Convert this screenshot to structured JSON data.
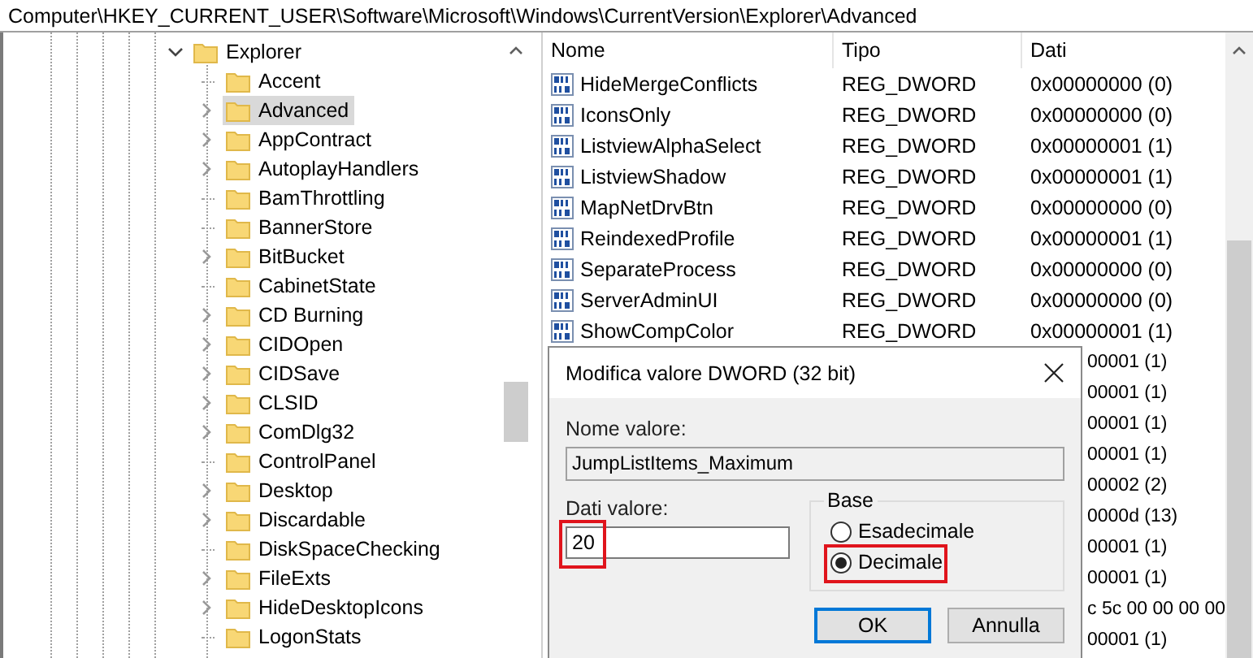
{
  "address_bar": "Computer\\HKEY_CURRENT_USER\\Software\\Microsoft\\Windows\\CurrentVersion\\Explorer\\Advanced",
  "tree": {
    "label": "Explorer",
    "expanded": true,
    "children": [
      {
        "label": "Accent",
        "expandable": false,
        "selected": false
      },
      {
        "label": "Advanced",
        "expandable": true,
        "selected": true
      },
      {
        "label": "AppContract",
        "expandable": true,
        "selected": false
      },
      {
        "label": "AutoplayHandlers",
        "expandable": true,
        "selected": false
      },
      {
        "label": "BamThrottling",
        "expandable": false,
        "selected": false
      },
      {
        "label": "BannerStore",
        "expandable": false,
        "selected": false
      },
      {
        "label": "BitBucket",
        "expandable": true,
        "selected": false
      },
      {
        "label": "CabinetState",
        "expandable": false,
        "selected": false
      },
      {
        "label": "CD Burning",
        "expandable": true,
        "selected": false
      },
      {
        "label": "CIDOpen",
        "expandable": true,
        "selected": false
      },
      {
        "label": "CIDSave",
        "expandable": true,
        "selected": false
      },
      {
        "label": "CLSID",
        "expandable": true,
        "selected": false
      },
      {
        "label": "ComDlg32",
        "expandable": true,
        "selected": false
      },
      {
        "label": "ControlPanel",
        "expandable": false,
        "selected": false
      },
      {
        "label": "Desktop",
        "expandable": true,
        "selected": false
      },
      {
        "label": "Discardable",
        "expandable": true,
        "selected": false
      },
      {
        "label": "DiskSpaceChecking",
        "expandable": false,
        "selected": false
      },
      {
        "label": "FileExts",
        "expandable": true,
        "selected": false
      },
      {
        "label": "HideDesktopIcons",
        "expandable": true,
        "selected": false
      },
      {
        "label": "LogonStats",
        "expandable": false,
        "selected": false
      }
    ]
  },
  "table": {
    "columns": [
      "Nome",
      "Tipo",
      "Dati"
    ],
    "rows": [
      {
        "kind": "full",
        "name": "HideMergeConflicts",
        "type": "REG_DWORD",
        "data": "0x00000000 (0)"
      },
      {
        "kind": "full",
        "name": "IconsOnly",
        "type": "REG_DWORD",
        "data": "0x00000000 (0)"
      },
      {
        "kind": "full",
        "name": "ListviewAlphaSelect",
        "type": "REG_DWORD",
        "data": "0x00000001 (1)"
      },
      {
        "kind": "full",
        "name": "ListviewShadow",
        "type": "REG_DWORD",
        "data": "0x00000001 (1)"
      },
      {
        "kind": "full",
        "name": "MapNetDrvBtn",
        "type": "REG_DWORD",
        "data": "0x00000000 (0)"
      },
      {
        "kind": "full",
        "name": "ReindexedProfile",
        "type": "REG_DWORD",
        "data": "0x00000001 (1)"
      },
      {
        "kind": "full",
        "name": "SeparateProcess",
        "type": "REG_DWORD",
        "data": "0x00000000 (0)"
      },
      {
        "kind": "full",
        "name": "ServerAdminUI",
        "type": "REG_DWORD",
        "data": "0x00000000 (0)"
      },
      {
        "kind": "full",
        "name": "ShowCompColor",
        "type": "REG_DWORD",
        "data": "0x00000001 (1)"
      },
      {
        "kind": "covered",
        "data": "00001 (1)"
      },
      {
        "kind": "covered",
        "data": "00001 (1)"
      },
      {
        "kind": "covered",
        "data": "00001 (1)"
      },
      {
        "kind": "covered",
        "data": "00001 (1)"
      },
      {
        "kind": "covered",
        "data": "00002 (2)"
      },
      {
        "kind": "covered",
        "data": "0000d (13)"
      },
      {
        "kind": "covered",
        "data": "00001 (1)"
      },
      {
        "kind": "covered",
        "data": "00001 (1)"
      },
      {
        "kind": "covered",
        "data": "c 5c 00 00 00 00"
      },
      {
        "kind": "covered",
        "data": "00001 (1)"
      }
    ]
  },
  "dialog": {
    "title": "Modifica valore DWORD (32 bit)",
    "name_label": "Nome valore:",
    "name_value": "JumpListItems_Maximum",
    "data_label": "Dati valore:",
    "data_value": "20",
    "data_highlighted": true,
    "base": {
      "label": "Base",
      "options": [
        {
          "label": "Esadecimale",
          "selected": false,
          "highlighted": false
        },
        {
          "label": "Decimale",
          "selected": true,
          "highlighted": true
        }
      ]
    },
    "buttons": [
      {
        "label": "OK",
        "default": true
      },
      {
        "label": "Annulla",
        "default": false
      }
    ]
  }
}
